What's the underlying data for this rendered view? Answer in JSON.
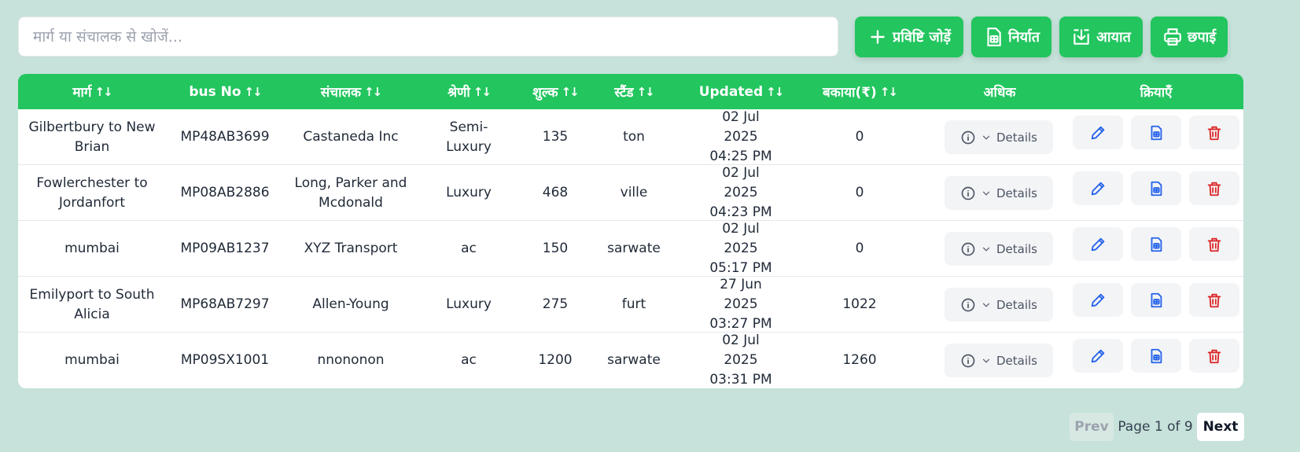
{
  "search": {
    "placeholder": "मार्ग या संचालक से खोजें...",
    "value": ""
  },
  "toolbar": {
    "add_label": "प्रविष्टि जोड़ें",
    "export_label": "निर्यात",
    "import_label": "आयात",
    "print_label": "छपाई"
  },
  "table": {
    "headers": [
      "मार्ग",
      "bus No",
      "संचालक",
      "श्रेणी",
      "शुल्क",
      "स्टैंड",
      "Updated",
      "बकाया(₹)",
      "अधिक",
      "क्रियाएँ"
    ],
    "sort_glyph": "↑↓",
    "details_label": "Details",
    "rows": [
      {
        "route": "Gilbertbury to New Brian",
        "bus_no": "MP48AB3699",
        "operator": "Castaneda Inc",
        "category": "Semi-Luxury",
        "fee": "135",
        "stand": "ton",
        "updated": "02 Jul 2025 04:25 PM",
        "due": "0"
      },
      {
        "route": "Fowlerchester to Jordanfort",
        "bus_no": "MP08AB2886",
        "operator": "Long, Parker and Mcdonald",
        "category": "Luxury",
        "fee": "468",
        "stand": "ville",
        "updated": "02 Jul 2025 04:23 PM",
        "due": "0"
      },
      {
        "route": "mumbai",
        "bus_no": "MP09AB1237",
        "operator": "XYZ Transport",
        "category": "ac",
        "fee": "150",
        "stand": "sarwate",
        "updated": "02 Jul 2025 05:17 PM",
        "due": "0"
      },
      {
        "route": "Emilyport to South Alicia",
        "bus_no": "MP68AB7297",
        "operator": "Allen-Young",
        "category": "Luxury",
        "fee": "275",
        "stand": "furt",
        "updated": "27 Jun 2025 03:27 PM",
        "due": "1022"
      },
      {
        "route": "mumbai",
        "bus_no": "MP09SX1001",
        "operator": "nnononon",
        "category": "ac",
        "fee": "1200",
        "stand": "sarwate",
        "updated": "02 Jul 2025 03:31 PM",
        "due": "1260"
      }
    ]
  },
  "pagination": {
    "prev_label": "Prev",
    "page_info": "Page 1 of 9",
    "next_label": "Next"
  },
  "colors": {
    "accent": "#22c55e",
    "background": "#c6e2da",
    "edit": "#2563eb",
    "doc": "#2563eb",
    "delete": "#dc2626"
  },
  "icons": {
    "add": "plus-icon",
    "export": "spreadsheet-icon",
    "import": "download-icon",
    "print": "printer-icon",
    "info": "info-icon",
    "chevron": "chevron-down-icon",
    "edit": "pencil-icon",
    "doc": "document-icon",
    "delete": "trash-icon"
  }
}
